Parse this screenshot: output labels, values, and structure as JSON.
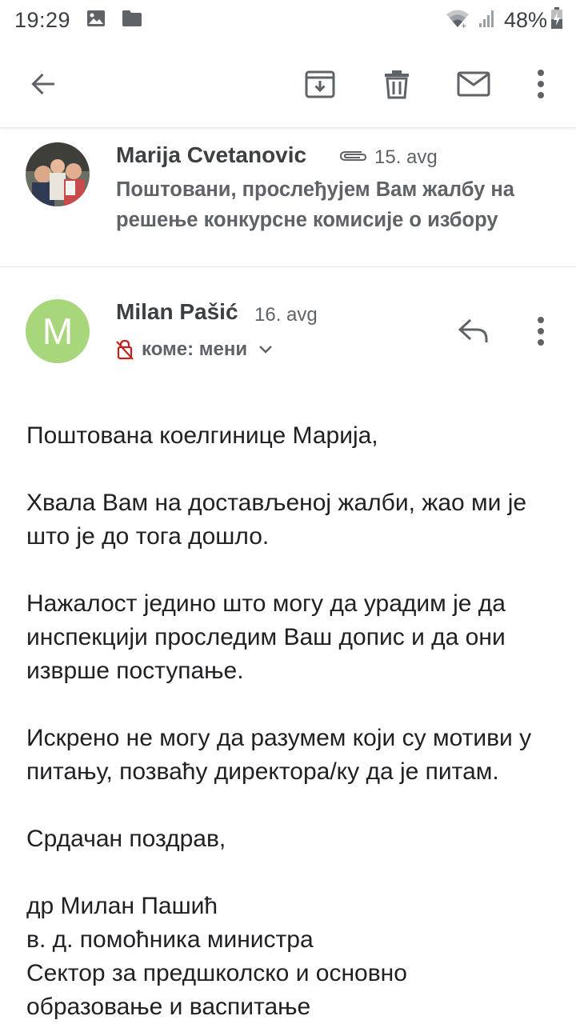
{
  "status_bar": {
    "time": "19:29",
    "battery": "48%"
  },
  "toolbar": {
    "back_icon": "arrow-back-icon",
    "archive_icon": "archive-icon",
    "delete_icon": "trash-icon",
    "mark_unread_icon": "mail-icon",
    "more_icon": "more-vert-icon"
  },
  "collapsed_message": {
    "sender": "Marija Cvetanovic",
    "date": "15. avg",
    "snippet": "Поштовани, прослеђујем Вам жалбу на решење конкурсне комисије о избору",
    "has_attachment": true
  },
  "expanded_message": {
    "avatar_letter": "M",
    "avatar_color": "#a8d67b",
    "sender": "Milan Pašić",
    "date": "16. avg",
    "to_label": "коме: мени",
    "body": {
      "greeting": "Поштована коелгинице Марија,",
      "p1": "Хвала Вам на достављеној жалби, жао ми је што је до тога дошло.",
      "p2": "Нажалост једино што могу да урадим је да инспекцији проследим Ваш допис и да они изврше поступање.",
      "p3": "Искрено не могу да разумем који су мотиви у питању, позваћу директора/ку да је питам.",
      "closing": "Срдачан поздрав,",
      "sig_name": "др Милан Пашић",
      "sig_title": "в. д. помоћника министра",
      "sig_dept_1": "Сектор за предшколско и основно",
      "sig_dept_2": "образовање и васпитање"
    }
  }
}
